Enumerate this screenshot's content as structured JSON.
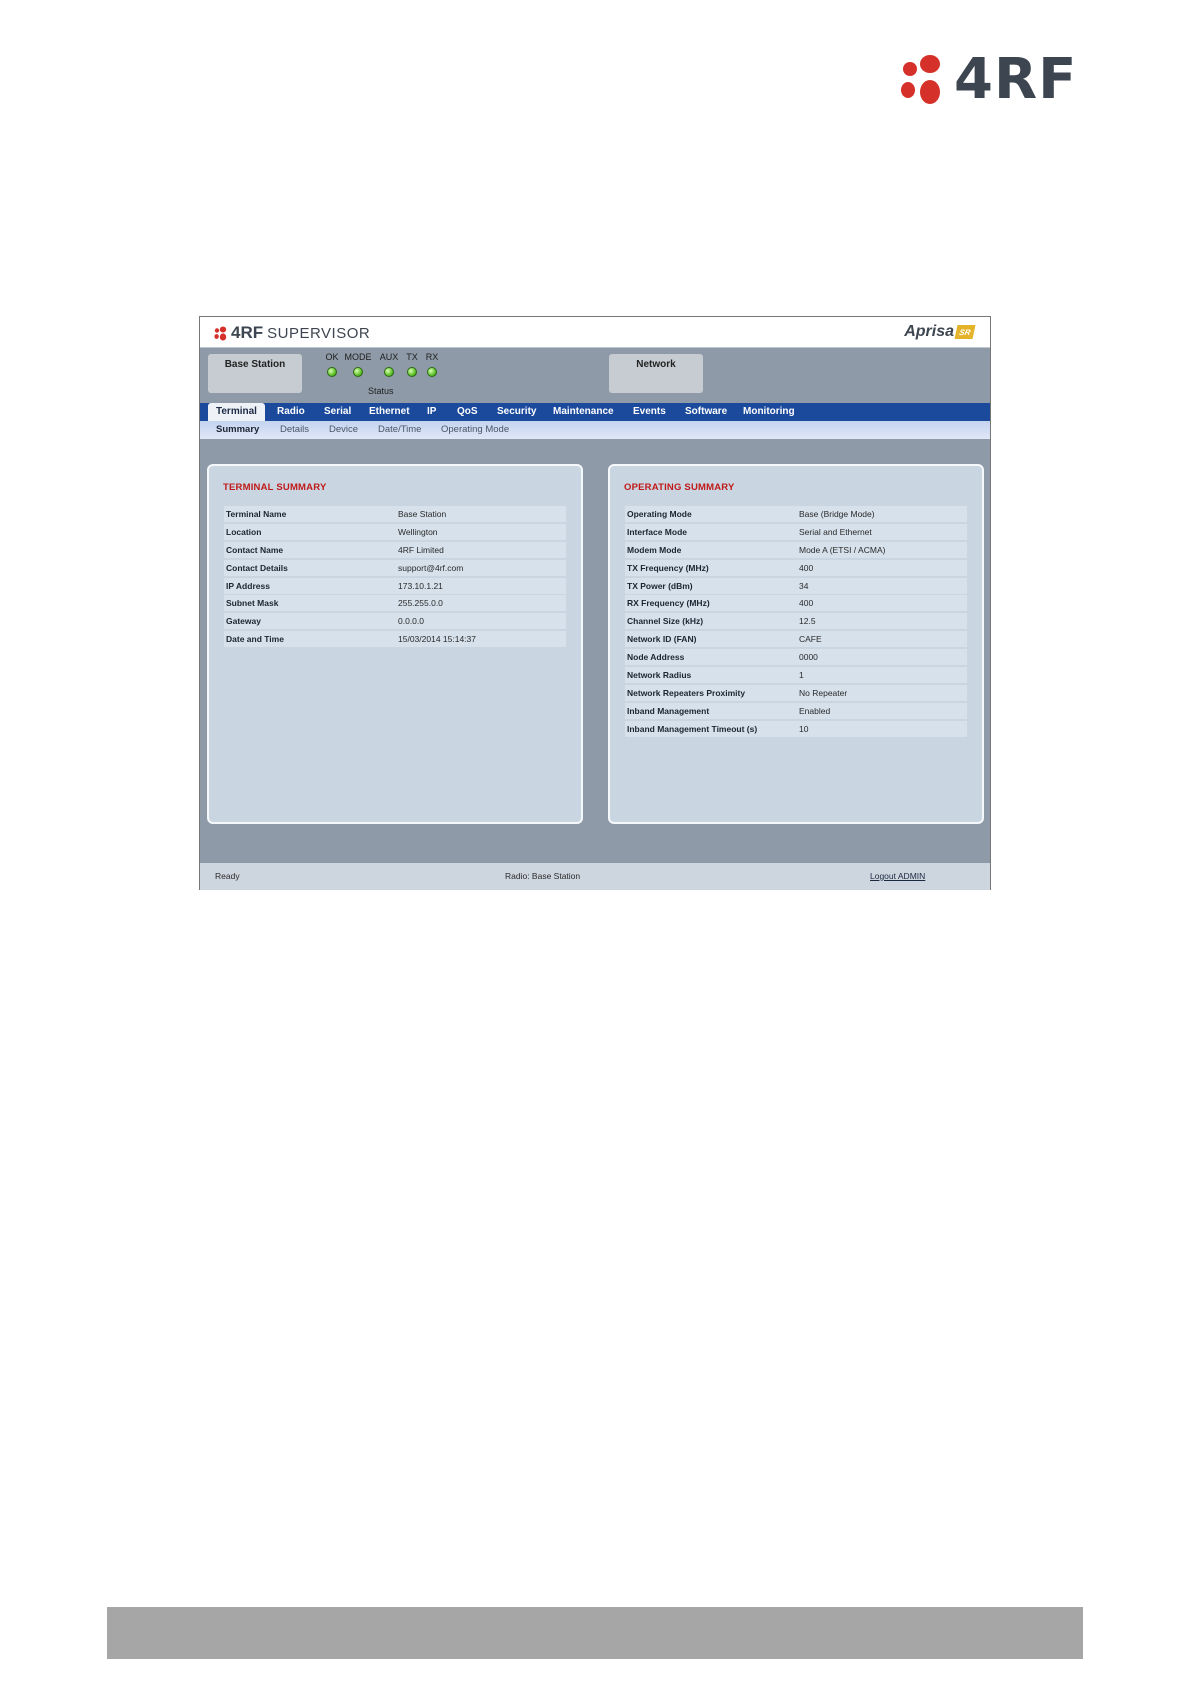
{
  "page_logo": {
    "text": "4RF"
  },
  "app": {
    "brand": "4RF",
    "product": "SUPERVISOR",
    "aprisa": {
      "name": "Aprisa",
      "badge": "SR"
    },
    "base_station_label": "Base Station",
    "network_label": "Network",
    "leds": [
      "OK",
      "MODE",
      "AUX",
      "TX",
      "RX"
    ],
    "status_label": "Status",
    "nav": [
      "Terminal",
      "Radio",
      "Serial",
      "Ethernet",
      "IP",
      "QoS",
      "Security",
      "Maintenance",
      "Events",
      "Software",
      "Monitoring"
    ],
    "subnav": [
      "Summary",
      "Details",
      "Device",
      "Date/Time",
      "Operating Mode"
    ],
    "terminal_summary": {
      "title": "TERMINAL SUMMARY",
      "rows": [
        [
          "Terminal Name",
          "Base Station"
        ],
        [
          "Location",
          "Wellington"
        ],
        [
          "Contact Name",
          "4RF Limited"
        ],
        [
          "Contact Details",
          "support@4rf.com"
        ],
        [
          "IP Address",
          "173.10.1.21"
        ],
        [
          "Subnet Mask",
          "255.255.0.0"
        ],
        [
          "Gateway",
          "0.0.0.0"
        ],
        [
          "Date and Time",
          "15/03/2014 15:14:37"
        ]
      ]
    },
    "operating_summary": {
      "title": "OPERATING SUMMARY",
      "rows": [
        [
          "Operating Mode",
          "Base (Bridge Mode)"
        ],
        [
          "Interface Mode",
          "Serial and Ethernet"
        ],
        [
          "Modem Mode",
          "Mode A (ETSI / ACMA)"
        ],
        [
          "TX Frequency (MHz)",
          "400"
        ],
        [
          "TX Power (dBm)",
          "34"
        ],
        [
          "RX Frequency (MHz)",
          "400"
        ],
        [
          "Channel Size (kHz)",
          "12.5"
        ],
        [
          "Network ID (FAN)",
          "CAFE"
        ],
        [
          "Node Address",
          "0000"
        ],
        [
          "Network Radius",
          "1"
        ],
        [
          "Network Repeaters Proximity",
          "No Repeater"
        ],
        [
          "Inband Management",
          "Enabled"
        ],
        [
          "Inband Management Timeout (s)",
          "10"
        ]
      ]
    },
    "footer": {
      "status": "Ready",
      "radio": "Radio: Base Station",
      "logout": "Logout ADMIN"
    }
  },
  "colors": {
    "brand_red": "#d6302a",
    "nav_blue": "#1b4a9d",
    "panel_title_red": "#c01818",
    "led_green": "#5fc22b"
  }
}
